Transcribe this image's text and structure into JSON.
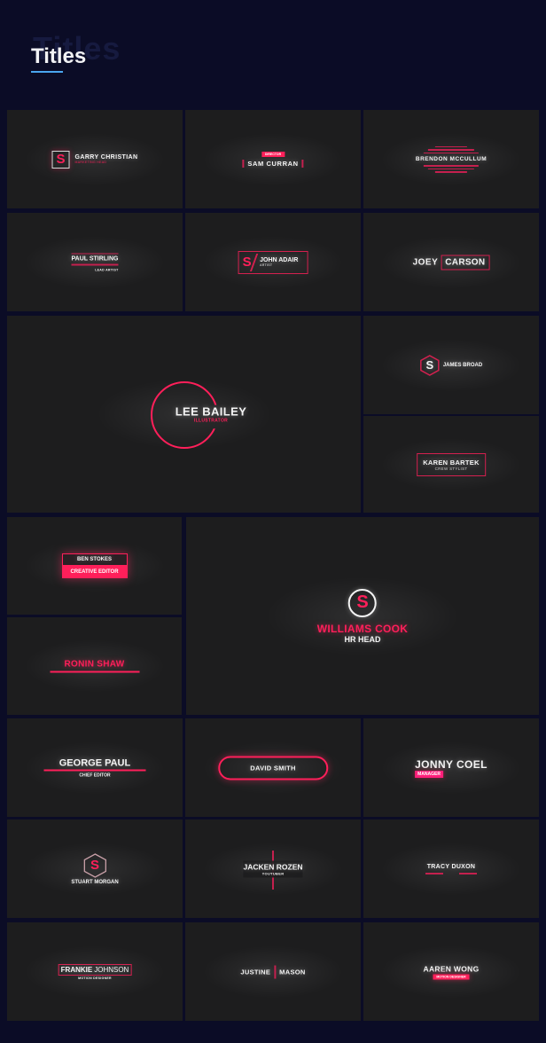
{
  "header": {
    "title": "Titles",
    "ghost_title": "Titles",
    "accent_color": "#4aa6ef"
  },
  "colors": {
    "background": "#0b0c26",
    "tile": "#1d1d1e",
    "accent": "#ff1f5a"
  },
  "tiles": [
    {
      "name": "GARRY CHRISTIAN",
      "role": "MARKETING HEAD",
      "logo": "S"
    },
    {
      "name": "SAM CURRAN",
      "role": "DIRECTOR"
    },
    {
      "name": "BRENDON MCCULLUM"
    },
    {
      "name": "PAUL STIRLING",
      "role": "LEAD ARTIST"
    },
    {
      "name": "JOHN ADAIR",
      "role": "ARTIST",
      "logo": "S"
    },
    {
      "first": "JOEY",
      "last": "CARSON"
    },
    {
      "name": "LEE BAILEY",
      "role": "ILLUSTRATOR"
    },
    {
      "name": "JAMES BROAD",
      "logo": "S"
    },
    {
      "name": "KAREN BARTEK",
      "role": "CREW STYLIST"
    },
    {
      "name": "BEN STOKES",
      "role": "CREATIVE EDITOR"
    },
    {
      "name": "RONIN SHAW"
    },
    {
      "name": "WILLIAMS COOK",
      "role": "HR HEAD",
      "logo": "S"
    },
    {
      "name": "GEORGE PAUL",
      "role": "CHIEF EDITOR"
    },
    {
      "name": "DAVID SMITH"
    },
    {
      "name": "JONNY COEL",
      "role": "MANAGER"
    },
    {
      "name": "STUART MORGAN",
      "logo": "S"
    },
    {
      "name": "JACKEN ROZEN",
      "role": "YOUTUBER"
    },
    {
      "name": "TRACY DUXON"
    },
    {
      "first": "FRANKIE",
      "last": "JOHNSON",
      "role": "MOTION DESIGNER"
    },
    {
      "first": "JUSTINE",
      "last": "MASON"
    },
    {
      "name": "AAREN WONG",
      "role": "MOTION DESIGNER"
    }
  ]
}
